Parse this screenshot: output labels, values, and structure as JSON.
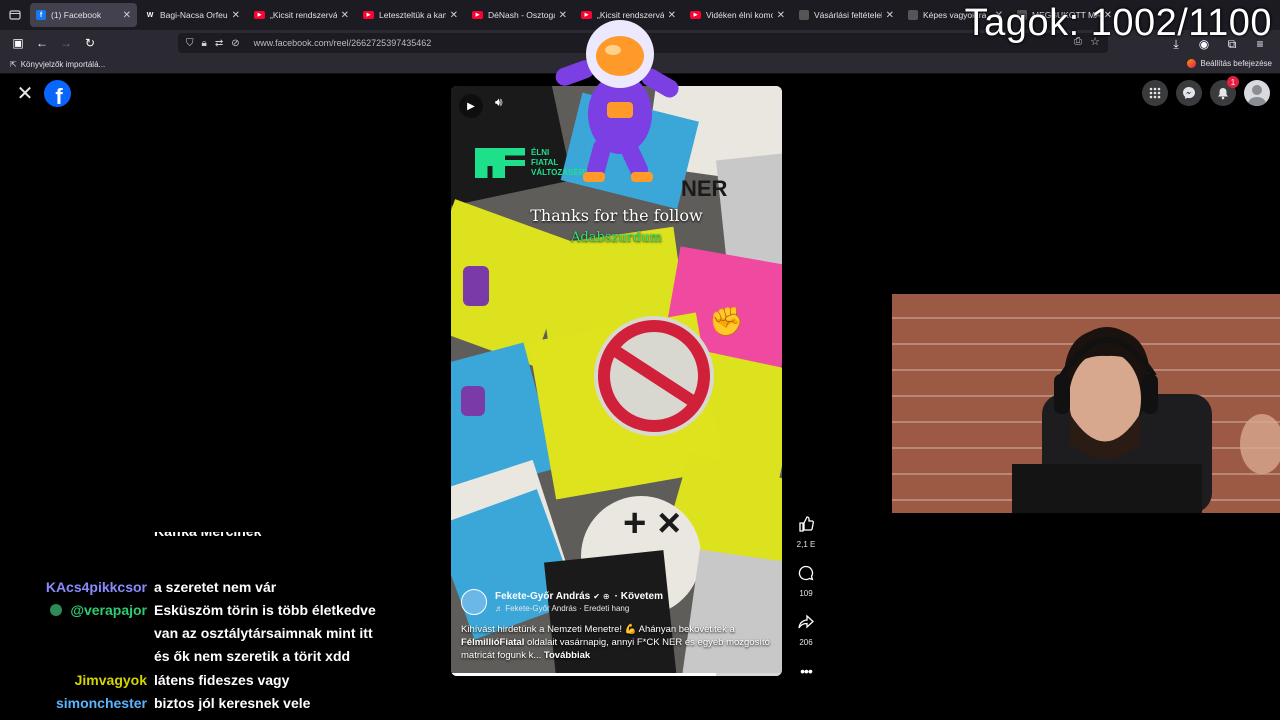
{
  "browser": {
    "tabs": [
      {
        "title": "(1) Facebook",
        "favicon": "facebook-icon",
        "active": true
      },
      {
        "title": "Bagi-Nacsa Orfeum",
        "favicon": "w-icon"
      },
      {
        "title": "„Kicsit rendszerválto",
        "favicon": "youtube-icon"
      },
      {
        "title": "Leteszteltük a kamp",
        "favicon": "youtube-icon"
      },
      {
        "title": "DéNash - Osztogat",
        "favicon": "youtube-icon"
      },
      {
        "title": "„Kicsit rendszerválto",
        "favicon": "youtube-icon"
      },
      {
        "title": "Vidéken élni komol",
        "favicon": "youtube-icon"
      },
      {
        "title": "Vásárlási feltételek",
        "favicon": "generic-icon"
      },
      {
        "title": "Képes vagyok ra",
        "favicon": "generic-icon"
      },
      {
        "title": "MEGBUKOTT MÁRI",
        "favicon": "generic-icon"
      }
    ],
    "url": "www.facebook.com/reel/2662725397435462",
    "bookmarks_left": "Könyvjelzők importálá...",
    "bookmarks_right": "Beállítás befejezése"
  },
  "overlay": {
    "member_count": "Tagok: 1002/1100"
  },
  "facebook": {
    "notifications_count": "1",
    "reel": {
      "brand_text_lines": [
        "ÉLNI",
        "FIATAL",
        "VÁLTOZÁSÉRT"
      ],
      "alert_title": "Thanks for the follow",
      "alert_user": "Adabszurdum",
      "author_name": "Fekete-Győr András",
      "verified_mark": "✔",
      "follow_label": "· Követem",
      "audio_label": "♬ Fekete-Győr András · Eredeti hang",
      "caption_part1": "Kihívást hirdetünk a Nemzeti Menetre! 💪 Ahányan bekövetitek a ",
      "caption_bold": "FélmillióFiatal",
      "caption_part2": " oldalait vasárnapig, annyi F*CK NER és egyéb mozgósító matricát fogunk k...",
      "caption_more": "Továbbiak",
      "progress": 0.8,
      "likes": "2,1 E",
      "comments": "109",
      "shares": "206"
    }
  },
  "chat": [
    {
      "user": "",
      "user_color": "#6a6aff",
      "message": "Kaffka Mercinek",
      "has_badge": false
    },
    {
      "user": "KAcs4pikkcsor",
      "user_color": "#8a8aff",
      "message": "a szeretet nem vár",
      "has_badge": false
    },
    {
      "user": "@verapajor",
      "user_color": "#2ecc71",
      "message": "Esküszöm törin is több életkedve van az osztálytársaimnak mint itt és ők nem szeretik a törit xdd",
      "has_badge": true
    },
    {
      "user": "Jimvagyok",
      "user_color": "#d4d400",
      "message": "látens fideszes vagy",
      "has_badge": false
    },
    {
      "user": "simonchester",
      "user_color": "#5ab4ff",
      "message": "biztos jól keresnek vele",
      "has_badge": false
    }
  ]
}
